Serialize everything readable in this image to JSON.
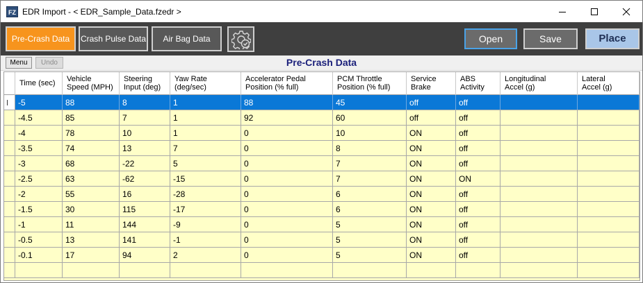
{
  "window": {
    "icon_text": "FZ",
    "title": "EDR Import - < EDR_Sample_Data.fzedr >"
  },
  "toolbar": {
    "tabs": [
      "Pre-Crash Data",
      "Crash Pulse Data",
      "Air Bag Data"
    ],
    "active_tab": "Pre-Crash Data",
    "open_label": "Open",
    "save_label": "Save",
    "place_label": "Place"
  },
  "subbar": {
    "menu_label": "Menu",
    "undo_label": "Undo",
    "section_title": "Pre-Crash Data"
  },
  "colors": {
    "accent_orange": "#f7941d",
    "selection_blue": "#0a78d7",
    "grid_background": "#ffffc8",
    "place_button": "#a9c6e8",
    "section_title": "#1a1f7a"
  },
  "table": {
    "columns": [
      [
        "Time (sec)"
      ],
      [
        "Vehicle",
        "Speed (MPH)"
      ],
      [
        "Steering",
        "Input (deg)"
      ],
      [
        "Yaw Rate",
        "(deg/sec)"
      ],
      [
        "Accelerator Pedal",
        "Position (% full)"
      ],
      [
        "PCM Throttle",
        "Position (% full)"
      ],
      [
        "Service",
        "Brake"
      ],
      [
        "ABS",
        "Activity"
      ],
      [
        "Longitudinal",
        "Accel (g)"
      ],
      [
        "Lateral",
        "Accel (g)"
      ]
    ],
    "selected_row": 0,
    "rows": [
      [
        "-5",
        "88",
        "8",
        "1",
        "88",
        "45",
        "off",
        "off",
        "",
        ""
      ],
      [
        "-4.5",
        "85",
        "7",
        "1",
        "92",
        "60",
        "off",
        "off",
        "",
        ""
      ],
      [
        "-4",
        "78",
        "10",
        "1",
        "0",
        "10",
        "ON",
        "off",
        "",
        ""
      ],
      [
        "-3.5",
        "74",
        "13",
        "7",
        "0",
        "8",
        "ON",
        "off",
        "",
        ""
      ],
      [
        "-3",
        "68",
        "-22",
        "5",
        "0",
        "7",
        "ON",
        "off",
        "",
        ""
      ],
      [
        "-2.5",
        "63",
        "-62",
        "-15",
        "0",
        "7",
        "ON",
        "ON",
        "",
        ""
      ],
      [
        "-2",
        "55",
        "16",
        "-28",
        "0",
        "6",
        "ON",
        "off",
        "",
        ""
      ],
      [
        "-1.5",
        "30",
        "115",
        "-17",
        "0",
        "6",
        "ON",
        "off",
        "",
        ""
      ],
      [
        "-1",
        "11",
        "144",
        "-9",
        "0",
        "5",
        "ON",
        "off",
        "",
        ""
      ],
      [
        "-0.5",
        "13",
        "141",
        "-1",
        "0",
        "5",
        "ON",
        "off",
        "",
        ""
      ],
      [
        "-0.1",
        "17",
        "94",
        "2",
        "0",
        "5",
        "ON",
        "off",
        "",
        ""
      ]
    ]
  }
}
